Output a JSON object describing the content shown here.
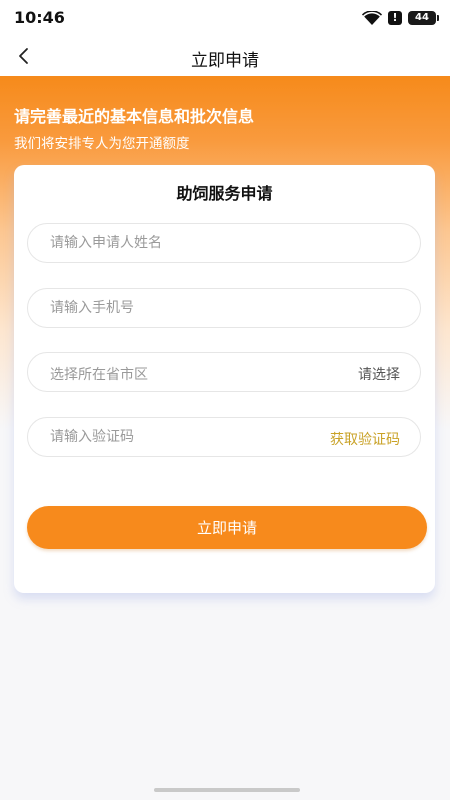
{
  "status_bar": {
    "time": "10:46",
    "battery": "44",
    "alert_glyph": "!",
    "icons": [
      "wifi-icon",
      "alert-icon",
      "battery-icon"
    ]
  },
  "nav": {
    "title": "立即申请",
    "back_icon": "chevron-left-icon"
  },
  "intro": {
    "title": "请完善最近的基本信息和批次信息",
    "subtitle": "我们将安排专人为您开通额度"
  },
  "form": {
    "title": "助饲服务申请",
    "name_placeholder": "请输入申请人姓名",
    "phone_placeholder": "请输入手机号",
    "region_label": "选择所在省市区",
    "region_action": "请选择",
    "code_placeholder": "请输入验证码",
    "code_action": "获取验证码",
    "submit_label": "立即申请"
  },
  "colors": {
    "accent": "#f78a1c",
    "code_action": "#c9a227",
    "region_action": "#555555",
    "placeholder": "#9a9a9a"
  }
}
